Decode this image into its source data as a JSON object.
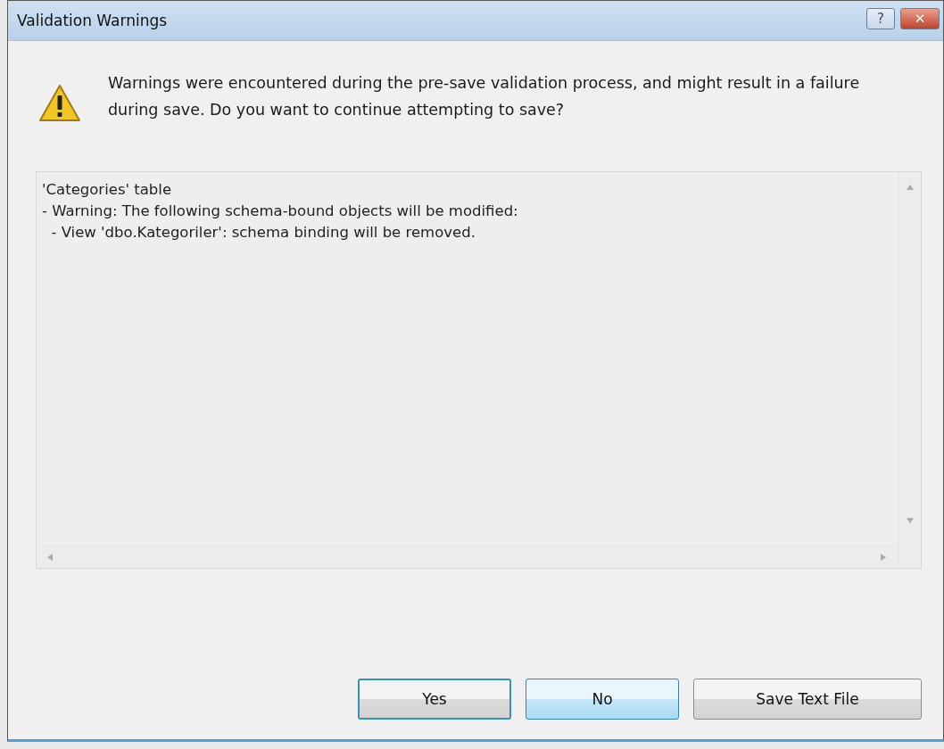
{
  "window": {
    "title": "Validation Warnings",
    "title_buttons": [
      {
        "kind": "help",
        "label": "?"
      },
      {
        "kind": "close",
        "label": "✕"
      }
    ]
  },
  "message": "Warnings were encountered during the pre-save validation process, and might result in a failure during save. Do you want to continue attempting to save?",
  "details": {
    "lines": [
      "'Categories' table",
      "- Warning: The following schema-bound objects will be modified:",
      "  - View 'dbo.Kategoriler': schema binding will be removed."
    ]
  },
  "buttons": [
    {
      "label": "Yes",
      "default": true,
      "hovered": false
    },
    {
      "label": "No",
      "default": false,
      "hovered": true
    },
    {
      "label": "Save Text File",
      "default": false,
      "hovered": false
    }
  ]
}
